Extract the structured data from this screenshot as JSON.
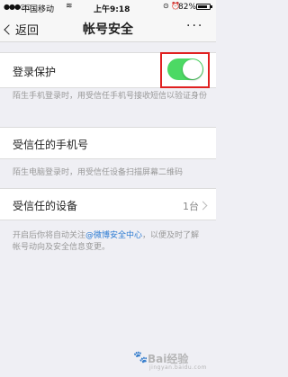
{
  "status_bar": {
    "signal": "●●●○○",
    "carrier": "中国移动",
    "time": "上午9:18",
    "battery": "82%",
    "battery_level": 0.82
  },
  "nav": {
    "back_label": "返回",
    "title": "帐号安全",
    "more_label": "···"
  },
  "login_protect": {
    "label": "登录保护",
    "enabled": true,
    "toggle_color": "#4cd964",
    "note": "陌生手机登录时，用受信任手机号接收短信以验证身份"
  },
  "trusted_phone": {
    "label": "受信任的手机号",
    "note": "陌生电脑登录时，用受信任设备扫描屏幕二维码"
  },
  "trusted_device": {
    "label": "受信任的设备",
    "count": "1台"
  },
  "footer": {
    "text_before": "开启后你将自动关注",
    "link_text": "@微博安全中心",
    "text_after": "，以便及时了解帐号动向及安全信息变更。"
  },
  "watermark": {
    "brand": "Bai经验",
    "sub": "jingyan.baidu.com"
  }
}
